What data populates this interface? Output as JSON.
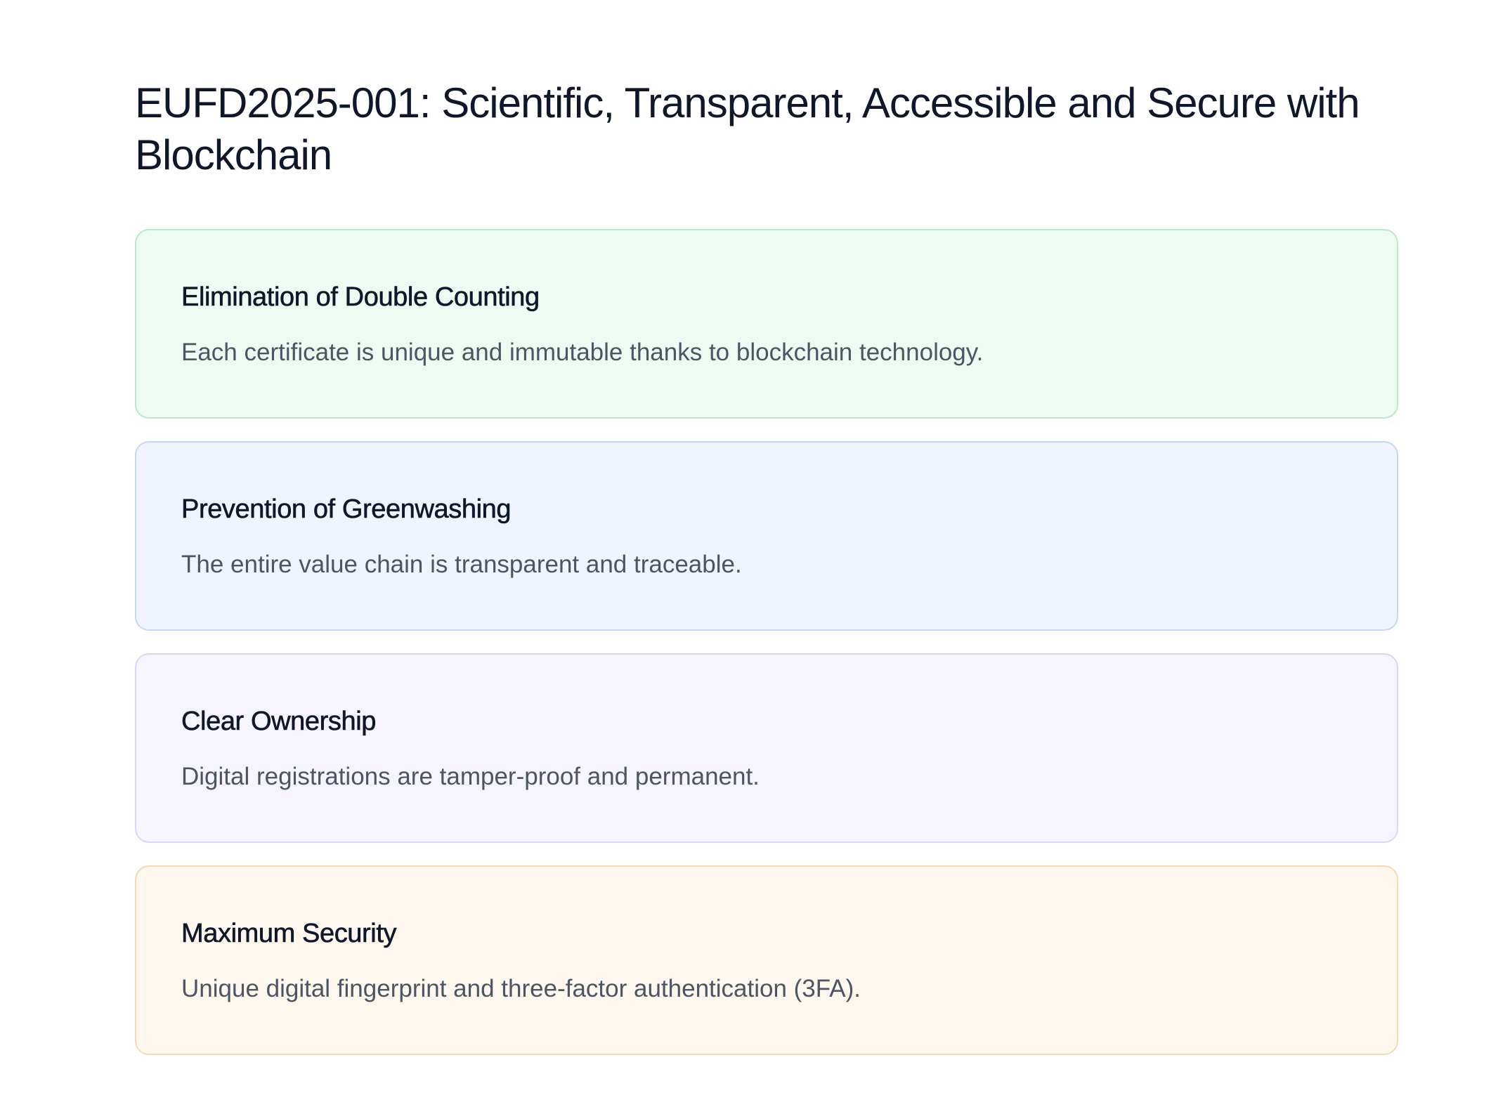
{
  "page": {
    "title": "EUFD2025-001: Scientific, Transparent, Accessible and Secure with Blockchain"
  },
  "cards": [
    {
      "title": "Elimination of Double Counting",
      "body": "Each certificate is unique and immutable thanks to blockchain technology.",
      "background": "#edfbf3",
      "border": "#b7e9cb"
    },
    {
      "title": "Prevention of Greenwashing",
      "body": "The entire value chain is transparent and traceable.",
      "background": "#eff4fe",
      "border": "#c5d7f4"
    },
    {
      "title": "Clear Ownership",
      "body": "Digital registrations are tamper-proof and permanent.",
      "background": "#f6f4fe",
      "border": "#dcd6f6"
    },
    {
      "title": "Maximum Security",
      "body": "Unique digital fingerprint and three-factor authentication (3FA).",
      "background": "#fef7ed",
      "border": "#f3dcb3"
    }
  ]
}
